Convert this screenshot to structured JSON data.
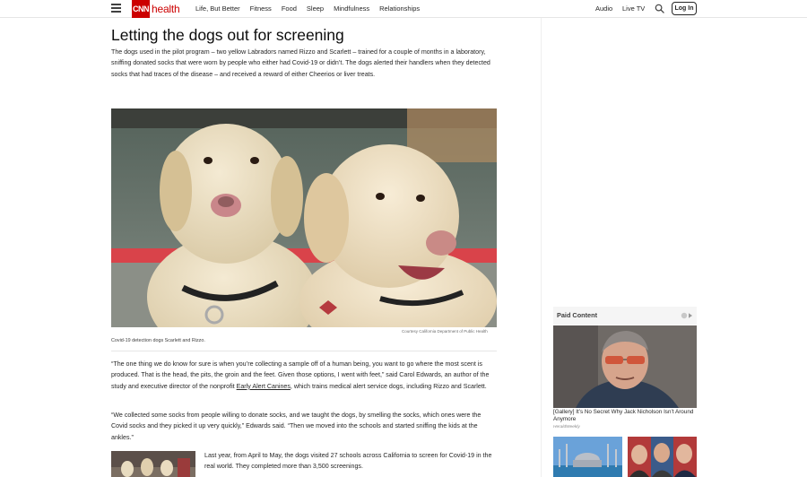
{
  "header": {
    "logo_box": "CNN",
    "logo_word": "health",
    "nav": [
      "Life, But Better",
      "Fitness",
      "Food",
      "Sleep",
      "Mindfulness",
      "Relationships"
    ],
    "audio": "Audio",
    "live_tv": "Live TV",
    "login": "Log In"
  },
  "article": {
    "headline": "Letting the dogs out for screening",
    "p1": "The dogs used in the pilot program – two yellow Labradors named Rizzo and Scarlett – trained for a couple of months in a laboratory, sniffing donated socks that were worn by people who either had Covid-19 or didn’t. The dogs alerted their handlers when they detected socks that had traces of the disease – and received a reward of either Cheerios or liver treats.",
    "image_credit": "Courtesy California Department of Public Health",
    "image_caption": "Covid-19 detection dogs Scarlett and Rizzo.",
    "p2_before_link": "“The one thing we do know for sure is when you’re collecting a sample off of a human being, you want to go where the most scent is produced. That is the head, the pits, the groin and the feet. Given those options, I went with feet,” said Carol Edwards, an author of the study and executive director of the nonprofit ",
    "p2_link": "Early Alert Canines",
    "p2_after_link": ", which trains medical alert service dogs, including Rizzo and Scarlett.",
    "p3": "“We collected some socks from people willing to donate socks, and we taught the dogs, by smelling the socks, which ones were the Covid socks and they picked it up very quickly,” Edwards said. “Then we moved into the schools and started sniffing the kids at the ankles.”",
    "p4": "Last year, from April to May, the dogs visited 27 schools across California to screen for Covid-19 in the real world. They completed more than 3,500 screenings."
  },
  "rail": {
    "paid_title": "Paid Content",
    "ad1_title": "[Gallery] It’s No Secret Why Jack Nicholson Isn’t Around Anymore",
    "ad1_source": "HeraldWeekly"
  },
  "colors": {
    "brand_red": "#cc0000",
    "text": "#262626"
  },
  "icons": {
    "menu": "hamburger-icon",
    "search": "search-icon",
    "adchoices": "adchoices-icon"
  }
}
